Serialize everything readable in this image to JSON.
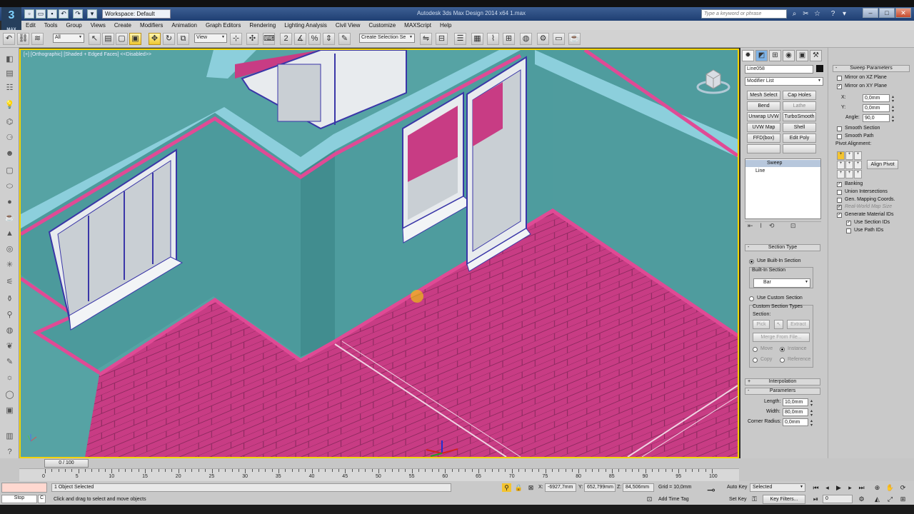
{
  "app": {
    "logo_text": "3",
    "logo_sub": "MAX",
    "title": "Autodesk 3ds Max Design 2014 x64    1.max",
    "workspace": "Workspace: Default",
    "search_placeholder": "Type a keyword or phrase",
    "window_buttons": {
      "minimize": "–",
      "maximize": "□",
      "close": "✕"
    }
  },
  "quick_access": [
    "▫",
    "▭",
    "▪",
    "↶",
    "↷",
    "▾"
  ],
  "title_icons": [
    "⌕",
    "✂",
    "☆",
    "?",
    "▾"
  ],
  "menu": [
    "Edit",
    "Tools",
    "Group",
    "Views",
    "Create",
    "Modifiers",
    "Animation",
    "Graph Editors",
    "Rendering",
    "Lighting Analysis",
    "Civil View",
    "Customize",
    "MAXScript",
    "Help"
  ],
  "toolbar": {
    "filter": "All",
    "ref_coord": "View",
    "selection_set": "Create Selection Se"
  },
  "viewport": {
    "label": "[+] [Orthographic] [Shaded + Edged Faces] <<Disabled>>",
    "colors": {
      "wall": "#4e9ea0",
      "floor": "#c83c84",
      "trim": "#e04a95",
      "top": "#8ccfdc",
      "window": "#e8ebee",
      "frame": "#3a36a8"
    }
  },
  "command_panel": {
    "object_name": "Line058",
    "modifier_list": "Modifier List",
    "modifier_buttons": [
      "Mesh Select",
      "Cap Holes",
      "Bend",
      "Lathe",
      "Unwrap UVW",
      "TurboSmooth",
      "UVW Map",
      "Shell",
      "FFD(box)",
      "Edit Poly"
    ],
    "stack": [
      "Sweep",
      "Line"
    ],
    "section_type": {
      "header": "Section Type",
      "use_builtin": "Use Built-In Section",
      "builtin_header": "Built-In Section",
      "builtin_value": "Bar",
      "use_custom": "Use Custom Section",
      "custom_types": "Custom Section Types",
      "section": "Section:",
      "pick": "Pick",
      "extract": "Extract",
      "merge": "Merge From File...",
      "move": "Move",
      "instance": "Instance",
      "copy": "Copy",
      "reference": "Reference"
    },
    "interpolation": "Interpolation",
    "parameters": {
      "header": "Parameters",
      "length_label": "Length:",
      "length": "10,0mm",
      "width_label": "Width:",
      "width": "80,0mm",
      "corner_label": "Corner Radius:",
      "corner": "0,0mm"
    }
  },
  "sweep_params": {
    "header": "Sweep Parameters",
    "mirror_xz": "Mirror on XZ Plane",
    "mirror_xy": "Mirror on XY Plane",
    "x_label": "X:",
    "x": "0,0mm",
    "y_label": "Y:",
    "y": "0,0mm",
    "angle_label": "Angle:",
    "angle": "90,0",
    "smooth_section": "Smooth Section",
    "smooth_path": "Smooth Path",
    "pivot_alignment": "Pivot Alignment:",
    "align_pivot": "Align Pivot",
    "banking": "Banking",
    "union": "Union Intersections",
    "gen_mapping": "Gen. Mapping Coords.",
    "real_world": "Real-World Map Size",
    "gen_material": "Generate Material IDs",
    "use_section_ids": "Use Section IDs",
    "use_path_ids": "Use Path IDs"
  },
  "timeline": {
    "frame": "0 / 100",
    "ticks": [
      "0",
      "5",
      "10",
      "15",
      "20",
      "25",
      "30",
      "35",
      "40",
      "45",
      "50",
      "55",
      "60",
      "65",
      "70",
      "75",
      "80",
      "85",
      "90",
      "95",
      "100"
    ]
  },
  "status": {
    "script_text": "Stop",
    "script_btn": "C",
    "selected": "1 Object Selected",
    "prompt": "Click and drag to select and move objects",
    "x_label": "X:",
    "x": "-6927,7mm",
    "y_label": "Y:",
    "y": "652,799mm",
    "z_label": "Z:",
    "z": "84,506mm",
    "grid": "Grid = 10,0mm",
    "add_time_tag": "Add Time Tag",
    "auto_key": "Auto Key",
    "set_key": "Set Key",
    "key_mode": "Selected",
    "key_filters": "Key Filters...",
    "frame_value": "0"
  }
}
